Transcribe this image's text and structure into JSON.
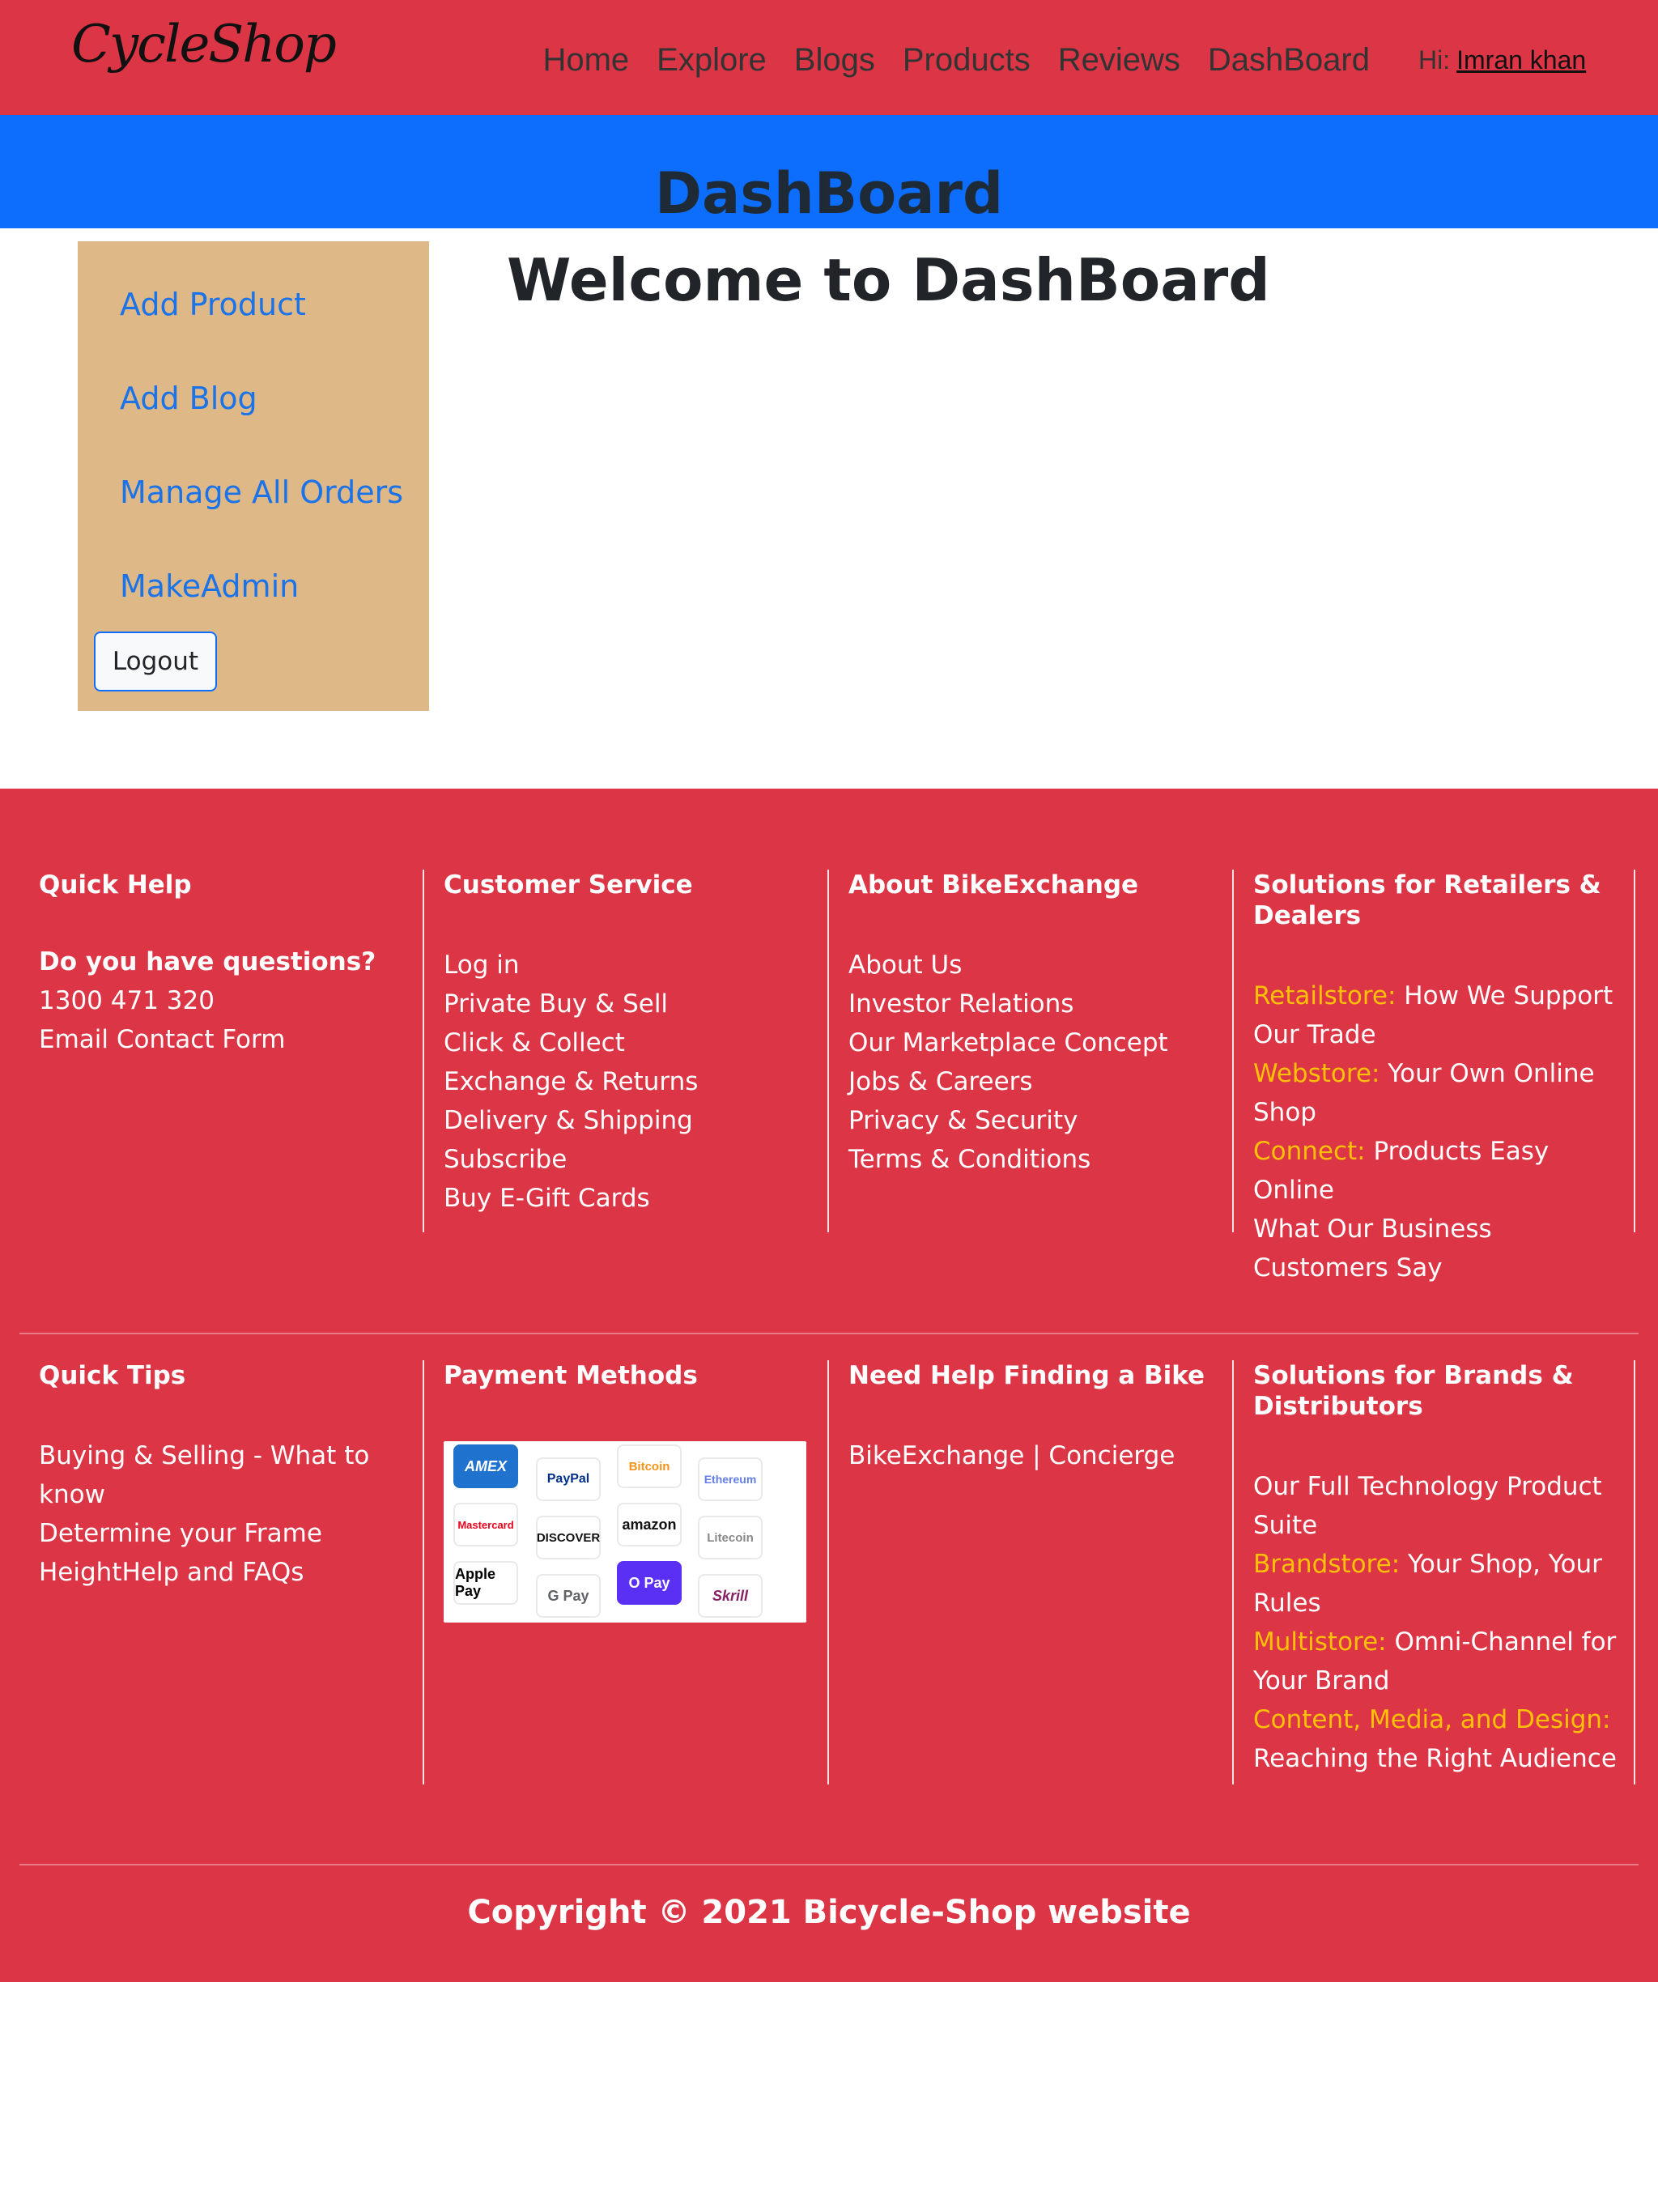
{
  "header": {
    "logo": "CycleShop",
    "nav": [
      "Home",
      "Explore",
      "Blogs",
      "Products",
      "Reviews",
      "DashBoard"
    ],
    "greeting": "Hi:",
    "user_name": "Imran khan"
  },
  "banner": {
    "title": "DashBoard"
  },
  "sidebar": {
    "links": [
      "Add Product",
      "Add Blog",
      "Manage All Orders",
      "MakeAdmin"
    ],
    "logout_label": "Logout"
  },
  "main": {
    "welcome": "Welcome to DashBoard"
  },
  "footer": {
    "quick_help": {
      "title": "Quick Help",
      "question": "Do you have questions?",
      "phone": "1300 471 320",
      "email": "Email Contact Form"
    },
    "customer_service": {
      "title": "Customer Service",
      "items": [
        "Log in",
        "Private Buy & Sell",
        "Click & Collect",
        "Exchange & Returns",
        "Delivery & Shipping",
        "Subscribe",
        "Buy E-Gift Cards"
      ]
    },
    "about": {
      "title": "About BikeExchange",
      "items": [
        "About Us",
        "Investor Relations",
        "Our Marketplace Concept",
        "Jobs & Careers",
        "Privacy & Security",
        "Terms & Conditions"
      ]
    },
    "retailers": {
      "title": "Solutions for Retailers & Dealers",
      "items": [
        {
          "highlight": "Retailstore:",
          "text": " How We Support Our Trade"
        },
        {
          "highlight": "Webstore:",
          "text": " Your Own Online Shop"
        },
        {
          "highlight": "Connect:",
          "text": " Products Easy Online"
        }
      ],
      "extra": "What Our Business Customers Say"
    },
    "quick_tips": {
      "title": "Quick Tips",
      "items": [
        "Buying & Selling - What to know",
        "Determine your Frame HeightHelp and FAQs"
      ]
    },
    "payment": {
      "title": "Payment Methods",
      "cards": [
        "AMEX",
        "PayPal",
        "Bitcoin",
        "Ethereum",
        "Mastercard",
        "DISCOVER",
        "amazon",
        "Litecoin",
        "Apple Pay",
        "G Pay",
        "O Pay",
        "Skrill"
      ]
    },
    "finding": {
      "title": "Need Help Finding a Bike",
      "items": [
        "BikeExchange | Concierge"
      ]
    },
    "brands": {
      "title": "Solutions for Brands & Distributors",
      "intro": "Our Full Technology Product Suite",
      "items": [
        {
          "highlight": "Brandstore:",
          "text": " Your Shop, Your Rules"
        },
        {
          "highlight": "Multistore:",
          "text": " Omni-Channel for Your Brand"
        },
        {
          "highlight": "Content, Media, and Design:",
          "text": " Reaching the Right Audience"
        }
      ]
    },
    "copyright": "Copyright © 2021 Bicycle-Shop website"
  },
  "colors": {
    "navbar": "#dc3545",
    "banner": "#0d6efd",
    "sidebar": "#deb887",
    "highlight": "#ffc107"
  }
}
